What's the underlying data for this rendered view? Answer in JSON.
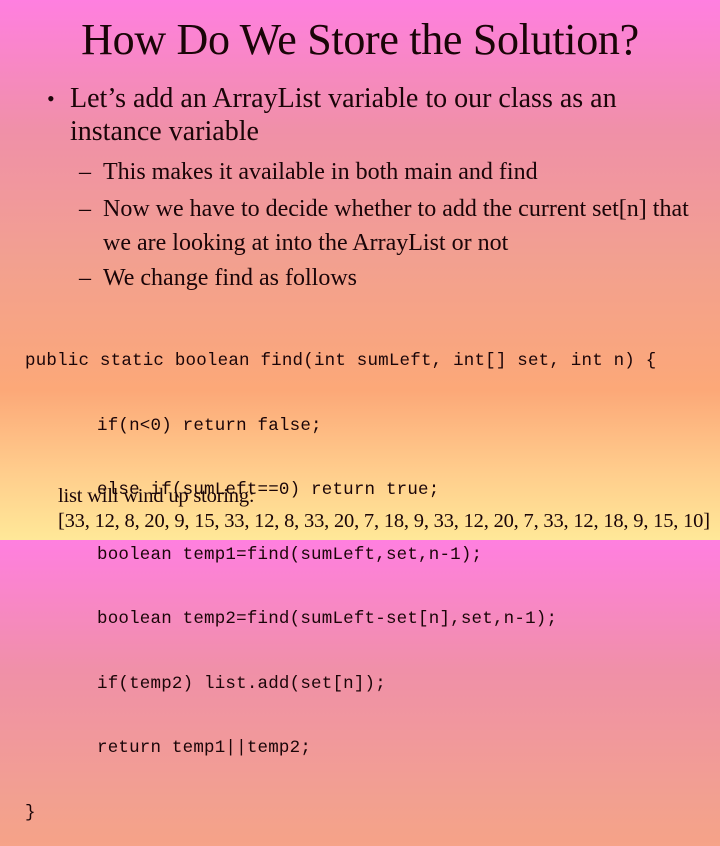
{
  "slide": {
    "title": "How Do We Store the Solution?",
    "background_gradient": [
      "#ff7fe0",
      "#f090a8",
      "#f2a090",
      "#fca878",
      "#ffe898"
    ],
    "text_color": "#1a0508"
  },
  "bullet": {
    "marker": "•",
    "text": "Let’s add an ArrayList variable to our class as an instance variable"
  },
  "subbullets": [
    {
      "marker": "–",
      "text": "This makes it available in both main and find"
    },
    {
      "marker": "–",
      "text": "Now we have to decide whether to add the current set[n] that we are looking at into the ArrayList or not"
    },
    {
      "marker": "–",
      "text": "We change find as follows"
    }
  ],
  "code": {
    "lines": [
      "public static boolean find(int sumLeft, int[] set, int n) {",
      "if(n<0) return false;",
      "else if(sumLeft==0) return true;",
      "boolean temp1=find(sumLeft,set,n-1);",
      "boolean temp2=find(sumLeft-set[n],set,n-1);",
      "if(temp2) list.add(set[n]);",
      "return temp1||temp2;",
      "}"
    ]
  },
  "result": {
    "label": "list will wind up storing:",
    "values": "[33, 12, 8, 20, 9, 15, 33, 12, 8, 33, 20, 7, 18, 9, 33, 12, 20, 7, 33, 12, 18, 9, 15, 10]"
  }
}
